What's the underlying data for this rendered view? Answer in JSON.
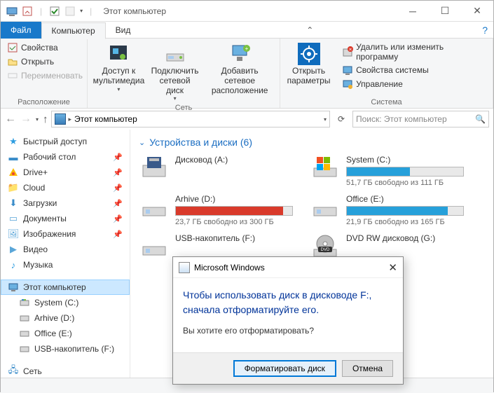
{
  "window": {
    "title": "Этот компьютер"
  },
  "tabs": {
    "file": "Файл",
    "computer": "Компьютер",
    "view": "Вид"
  },
  "ribbon": {
    "props": "Свойства",
    "open": "Открыть",
    "rename": "Переименовать",
    "group_location": "Расположение",
    "media_access": "Доступ к\nмультимедиа",
    "map_drive": "Подключить\nсетевой диск",
    "add_net_loc": "Добавить сетевое\nрасположение",
    "group_network": "Сеть",
    "open_settings": "Открыть\nпараметры",
    "uninstall": "Удалить или изменить программу",
    "sys_props": "Свойства системы",
    "manage": "Управление",
    "group_system": "Система"
  },
  "addressbar": {
    "crumb": "Этот компьютер"
  },
  "search": {
    "placeholder": "Поиск: Этот компьютер"
  },
  "tree": {
    "quick": "Быстрый доступ",
    "desktop": "Рабочий стол",
    "driveplus": "Drive+",
    "cloud": "Cloud",
    "downloads": "Загрузки",
    "documents": "Документы",
    "pictures": "Изображения",
    "videos": "Видео",
    "music": "Музыка",
    "thispc": "Этот компьютер",
    "systemc": "System (C:)",
    "arhived": "Arhive (D:)",
    "officee": "Office (E:)",
    "usbf": "USB-накопитель (F:)",
    "network": "Сеть"
  },
  "content": {
    "header": "Устройства и диски (6)",
    "drives": {
      "floppy": {
        "name": "Дисковод (A:)"
      },
      "systemc": {
        "name": "System (C:)",
        "stat": "51,7 ГБ свободно из 111 ГБ",
        "fill_pct": 54,
        "color": "#26a0da"
      },
      "arhived": {
        "name": "Arhive (D:)",
        "stat": "23,7 ГБ свободно из 300 ГБ",
        "fill_pct": 92,
        "color": "#d93a2b"
      },
      "officee": {
        "name": "Office (E:)",
        "stat": "21,9 ГБ свободно из 165 ГБ",
        "fill_pct": 87,
        "color": "#26a0da"
      },
      "usbf": {
        "name": "USB-накопитель (F:)"
      },
      "dvdg": {
        "name": "DVD RW дисковод (G:)"
      }
    }
  },
  "dialog": {
    "title": "Microsoft Windows",
    "message": "Чтобы использовать диск в дисководе F:, сначала отформатируйте его.",
    "sub": "Вы хотите его отформатировать?",
    "format_btn": "Форматировать диск",
    "cancel_btn": "Отмена"
  }
}
